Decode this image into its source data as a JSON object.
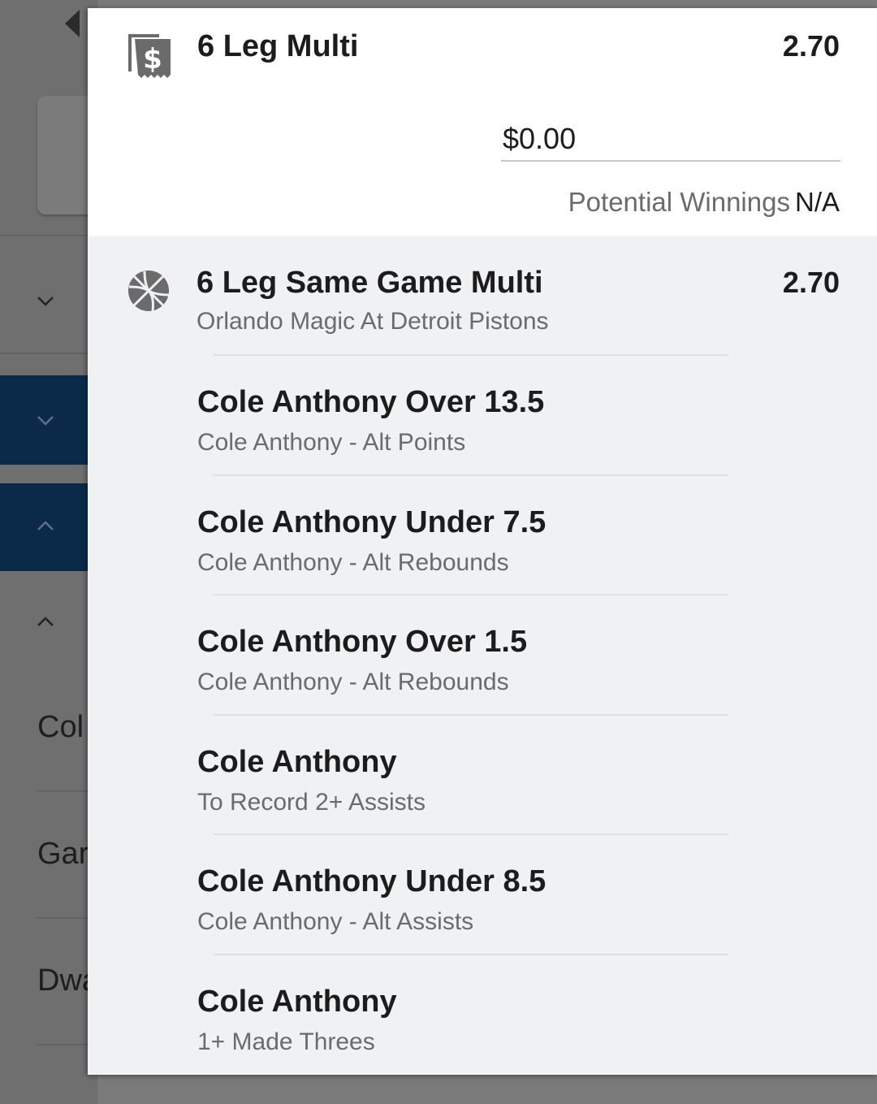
{
  "background": {
    "visible_names": [
      "Col",
      "Gar",
      "Dwa"
    ]
  },
  "multi": {
    "title": "6 Leg Multi",
    "odds": "2.70",
    "stake_value": "$0.00",
    "potential_winnings_label": "Potential Winnings",
    "potential_winnings_value": "N/A"
  },
  "sgm": {
    "title": "6 Leg Same Game Multi",
    "odds": "2.70",
    "subtitle": "Orlando Magic At Detroit Pistons",
    "legs": [
      {
        "title": "Cole Anthony Over 13.5",
        "subtitle": "Cole Anthony - Alt Points"
      },
      {
        "title": "Cole Anthony Under 7.5",
        "subtitle": "Cole Anthony - Alt Rebounds"
      },
      {
        "title": "Cole Anthony Over 1.5",
        "subtitle": "Cole Anthony - Alt Rebounds"
      },
      {
        "title": "Cole Anthony",
        "subtitle": "To Record 2+ Assists"
      },
      {
        "title": "Cole Anthony Under 8.5",
        "subtitle": "Cole Anthony - Alt Assists"
      },
      {
        "title": "Cole Anthony",
        "subtitle": "1+ Made Threes"
      }
    ]
  },
  "colors": {
    "overlay": "#6f6f6f",
    "navy": "#0b2a4a",
    "sheet_bg": "#ffffff",
    "section_bg": "#f0f1f3",
    "text_primary": "#1c1c1c",
    "text_secondary": "#6b6b6b"
  },
  "icons": [
    "back-arrow-icon",
    "chevron-down-icon",
    "chevron-up-icon",
    "receipt-dollar-icon",
    "basketball-icon"
  ]
}
